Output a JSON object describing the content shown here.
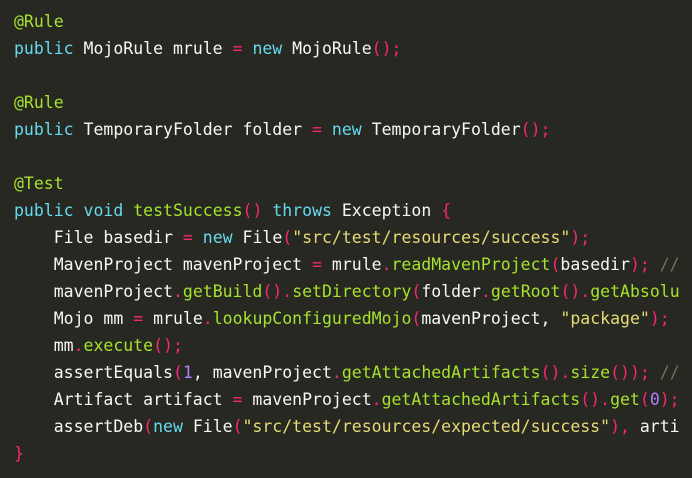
{
  "colors": {
    "background": "#272822",
    "default": "#f8f8f2",
    "keyword": "#66d9ef",
    "annotation": "#a6e22e",
    "method": "#a6e22e",
    "operator": "#f92672",
    "string": "#e6db74",
    "number": "#ae81ff",
    "comment": "#75715e"
  },
  "code_lines": [
    [
      [
        "annotation",
        "@Rule"
      ]
    ],
    [
      [
        "keyword",
        "public"
      ],
      [
        "default",
        " MojoRule mrule "
      ],
      [
        "operator",
        "="
      ],
      [
        "default",
        " "
      ],
      [
        "keyword",
        "new"
      ],
      [
        "default",
        " MojoRule"
      ],
      [
        "operator",
        "();"
      ]
    ],
    [],
    [
      [
        "annotation",
        "@Rule"
      ]
    ],
    [
      [
        "keyword",
        "public"
      ],
      [
        "default",
        " TemporaryFolder folder "
      ],
      [
        "operator",
        "="
      ],
      [
        "default",
        " "
      ],
      [
        "keyword",
        "new"
      ],
      [
        "default",
        " TemporaryFolder"
      ],
      [
        "operator",
        "();"
      ]
    ],
    [],
    [
      [
        "annotation",
        "@Test"
      ]
    ],
    [
      [
        "keyword",
        "public"
      ],
      [
        "default",
        " "
      ],
      [
        "keyword",
        "void"
      ],
      [
        "default",
        " "
      ],
      [
        "method",
        "testSuccess"
      ],
      [
        "operator",
        "()"
      ],
      [
        "default",
        " "
      ],
      [
        "keyword",
        "throws"
      ],
      [
        "default",
        " Exception "
      ],
      [
        "operator",
        "{"
      ]
    ],
    [
      [
        "default",
        "    File basedir "
      ],
      [
        "operator",
        "="
      ],
      [
        "default",
        " "
      ],
      [
        "keyword",
        "new"
      ],
      [
        "default",
        " File"
      ],
      [
        "operator",
        "("
      ],
      [
        "string",
        "\"src/test/resources/success\""
      ],
      [
        "operator",
        ");"
      ]
    ],
    [
      [
        "default",
        "    MavenProject mavenProject "
      ],
      [
        "operator",
        "="
      ],
      [
        "default",
        " mrule"
      ],
      [
        "operator",
        "."
      ],
      [
        "method",
        "readMavenProject"
      ],
      [
        "operator",
        "("
      ],
      [
        "default",
        "basedir"
      ],
      [
        "operator",
        ");"
      ],
      [
        "default",
        " "
      ],
      [
        "comment",
        "//"
      ]
    ],
    [
      [
        "default",
        "    mavenProject"
      ],
      [
        "operator",
        "."
      ],
      [
        "method",
        "getBuild"
      ],
      [
        "operator",
        "()."
      ],
      [
        "method",
        "setDirectory"
      ],
      [
        "operator",
        "("
      ],
      [
        "default",
        "folder"
      ],
      [
        "operator",
        "."
      ],
      [
        "method",
        "getRoot"
      ],
      [
        "operator",
        "()."
      ],
      [
        "method",
        "getAbsolu"
      ]
    ],
    [
      [
        "default",
        "    Mojo mm "
      ],
      [
        "operator",
        "="
      ],
      [
        "default",
        " mrule"
      ],
      [
        "operator",
        "."
      ],
      [
        "method",
        "lookupConfiguredMojo"
      ],
      [
        "operator",
        "("
      ],
      [
        "default",
        "mavenProject, "
      ],
      [
        "string",
        "\"package\""
      ],
      [
        "operator",
        ");"
      ]
    ],
    [
      [
        "default",
        "    mm"
      ],
      [
        "operator",
        "."
      ],
      [
        "method",
        "execute"
      ],
      [
        "operator",
        "();"
      ]
    ],
    [
      [
        "default",
        "    assertEquals"
      ],
      [
        "operator",
        "("
      ],
      [
        "number",
        "1"
      ],
      [
        "default",
        ", mavenProject"
      ],
      [
        "operator",
        "."
      ],
      [
        "method",
        "getAttachedArtifacts"
      ],
      [
        "operator",
        "()."
      ],
      [
        "method",
        "size"
      ],
      [
        "operator",
        "());"
      ],
      [
        "default",
        " "
      ],
      [
        "comment",
        "//"
      ]
    ],
    [
      [
        "default",
        "    Artifact artifact "
      ],
      [
        "operator",
        "="
      ],
      [
        "default",
        " mavenProject"
      ],
      [
        "operator",
        "."
      ],
      [
        "method",
        "getAttachedArtifacts"
      ],
      [
        "operator",
        "()."
      ],
      [
        "method",
        "get"
      ],
      [
        "operator",
        "("
      ],
      [
        "number",
        "0"
      ],
      [
        "operator",
        ");"
      ]
    ],
    [
      [
        "default",
        "    assertDeb"
      ],
      [
        "operator",
        "("
      ],
      [
        "keyword",
        "new"
      ],
      [
        "default",
        " File"
      ],
      [
        "operator",
        "("
      ],
      [
        "string",
        "\"src/test/resources/expected/success\""
      ],
      [
        "operator",
        "),"
      ],
      [
        "default",
        " arti"
      ]
    ],
    [
      [
        "operator",
        "}"
      ]
    ]
  ]
}
